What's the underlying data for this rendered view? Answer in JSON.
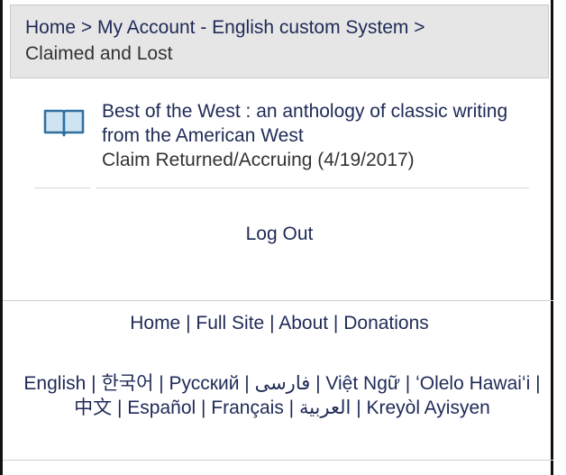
{
  "breadcrumb": {
    "home": "Home",
    "separator": " > ",
    "account": "My Account - English custom System",
    "current": "Claimed and Lost"
  },
  "item": {
    "icon": "book-icon",
    "title": "Best of the West : an anthology of classic writing from the American West",
    "status": "Claim Returned/Accruing (4/19/2017)"
  },
  "logout": "Log Out",
  "footer": {
    "links": [
      "Home",
      "Full Site",
      "About",
      "Donations"
    ],
    "separator": " | "
  },
  "languages": [
    "English",
    "한국어",
    "Русский",
    "فارسی",
    "Việt Ngữ",
    "ʻOlelo Hawaiʻi",
    "中文",
    "Español",
    "Français",
    "العربية",
    "Kreyòl Ayisyen"
  ],
  "colors": {
    "link": "#1f2a57",
    "header_bg": "#e6e6e6",
    "divider": "#d0d0d0"
  }
}
